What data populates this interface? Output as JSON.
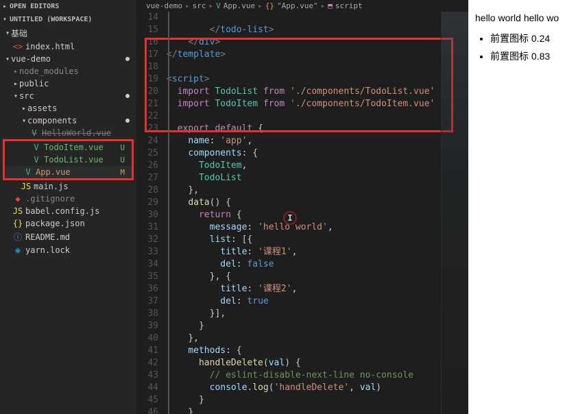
{
  "sidebar": {
    "sections": {
      "open_editors": "OPEN EDITORS",
      "workspace": "UNTITLED (WORKSPACE)"
    },
    "tree": {
      "root1": "基础",
      "index_html": "index.html",
      "vue_demo": "vue-demo",
      "node_modules": "node_modules",
      "public": "public",
      "src": "src",
      "assets": "assets",
      "components": "components",
      "hello_world": "HelloWorld.vue",
      "todo_item": "TodoItem.vue",
      "todo_list": "TodoList.vue",
      "app_vue": "App.vue",
      "main_js": "main.js",
      "gitignore": ".gitignore",
      "babel": "babel.config.js",
      "package_json": "package.json",
      "readme": "README.md",
      "yarn_lock": "yarn.lock"
    },
    "status": {
      "U": "U",
      "M": "M"
    }
  },
  "breadcrumb": {
    "b1": "vue-demo",
    "b2": "src",
    "b3": "App.vue",
    "b4": "\"App.vue\"",
    "b5": "script"
  },
  "code": {
    "ln14": "",
    "ln15": "        </todo-list>",
    "ln16": "    </div>",
    "ln17": "</template>",
    "ln18": "",
    "ln19": "<script>",
    "ln20": "  import TodoList from './components/TodoList.vue'",
    "ln21": "  import TodoItem from './components/TodoItem.vue'",
    "ln22": "",
    "ln23": "  export default {",
    "ln24": "    name: 'app',",
    "ln25": "    components: {",
    "ln26": "      TodoItem,",
    "ln27": "      TodoList",
    "ln28": "    },",
    "ln29": "    data() {",
    "ln30": "      return {",
    "ln31": "        message: 'hello world',",
    "ln32": "        list: [{",
    "ln33": "          title: '课程1',",
    "ln34": "          del: false",
    "ln35": "        }, {",
    "ln36": "          title: '课程2',",
    "ln37": "          del: true",
    "ln38": "        }],",
    "ln39": "      }",
    "ln40": "    },",
    "ln41": "    methods: {",
    "ln42": "      handleDelete(val) {",
    "ln43": "        // eslint-disable-next-line no-console",
    "ln44": "        console.log('handleDelete', val)",
    "ln45": "      }",
    "ln46": "    }"
  },
  "line_numbers": [
    "14",
    "15",
    "16",
    "17",
    "18",
    "19",
    "20",
    "21",
    "22",
    "23",
    "24",
    "25",
    "26",
    "27",
    "28",
    "29",
    "30",
    "31",
    "32",
    "33",
    "34",
    "35",
    "36",
    "37",
    "38",
    "39",
    "40",
    "41",
    "42",
    "43",
    "44",
    "45",
    "46"
  ],
  "browser": {
    "title": "hello world hello wo",
    "item1": "前置图标 0.24",
    "item2": "前置图标 0.83"
  }
}
